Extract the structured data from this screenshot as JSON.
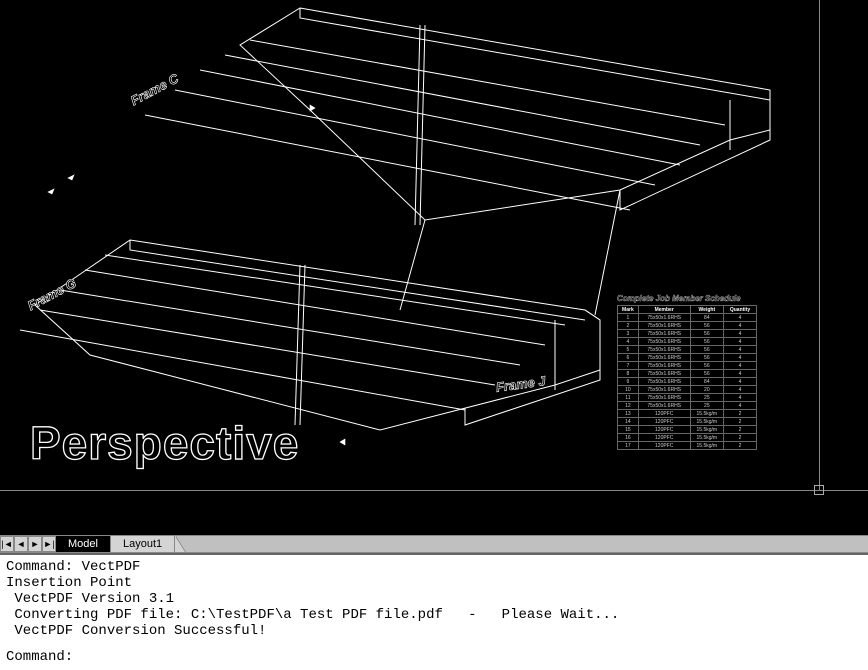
{
  "view": {
    "label": "Perspective"
  },
  "frames": {
    "c": "Frame C",
    "g": "Frame G",
    "j": "Frame J"
  },
  "schedule": {
    "title": "Complete Job Member Schedule",
    "headers": [
      "Mark",
      "Member",
      "Weight",
      "Quantity"
    ],
    "rows": [
      [
        "1",
        "75x50x1.6RHS",
        "84",
        "4"
      ],
      [
        "2",
        "75x50x1.6RHS",
        "56",
        "4"
      ],
      [
        "3",
        "75x50x1.6RHS",
        "56",
        "4"
      ],
      [
        "4",
        "75x50x1.6RHS",
        "56",
        "4"
      ],
      [
        "5",
        "75x50x1.6RHS",
        "56",
        "4"
      ],
      [
        "6",
        "75x50x1.6RHS",
        "56",
        "4"
      ],
      [
        "7",
        "75x50x1.6RHS",
        "56",
        "4"
      ],
      [
        "8",
        "75x50x1.6RHS",
        "56",
        "4"
      ],
      [
        "9",
        "75x50x1.6RHS",
        "84",
        "4"
      ],
      [
        "10",
        "75x50x1.6RHS",
        "20",
        "4"
      ],
      [
        "11",
        "75x50x1.6RHS",
        "25",
        "4"
      ],
      [
        "12",
        "75x50x1.6RHS",
        "25",
        "4"
      ],
      [
        "13",
        "120PFC",
        "15.5kg/m",
        "2"
      ],
      [
        "14",
        "120PFC",
        "15.5kg/m",
        "2"
      ],
      [
        "15",
        "120PFC",
        "15.5kg/m",
        "2"
      ],
      [
        "16",
        "120PFC",
        "15.5kg/m",
        "2"
      ],
      [
        "17",
        "120PFC",
        "15.5kg/m",
        "2"
      ]
    ]
  },
  "tabs": {
    "nav_first": "|◄",
    "nav_prev": "◄",
    "nav_next": "►",
    "nav_last": "►|",
    "model": "Model",
    "layout1": "Layout1"
  },
  "command": {
    "l1": "Command: VectPDF",
    "l2": "Insertion Point",
    "l3": " VectPDF Version 3.1",
    "l4": " Converting PDF file: C:\\TestPDF\\a Test PDF file.pdf   -   Please Wait...",
    "l5": " VectPDF Conversion Successful!",
    "prompt": "Command:"
  }
}
